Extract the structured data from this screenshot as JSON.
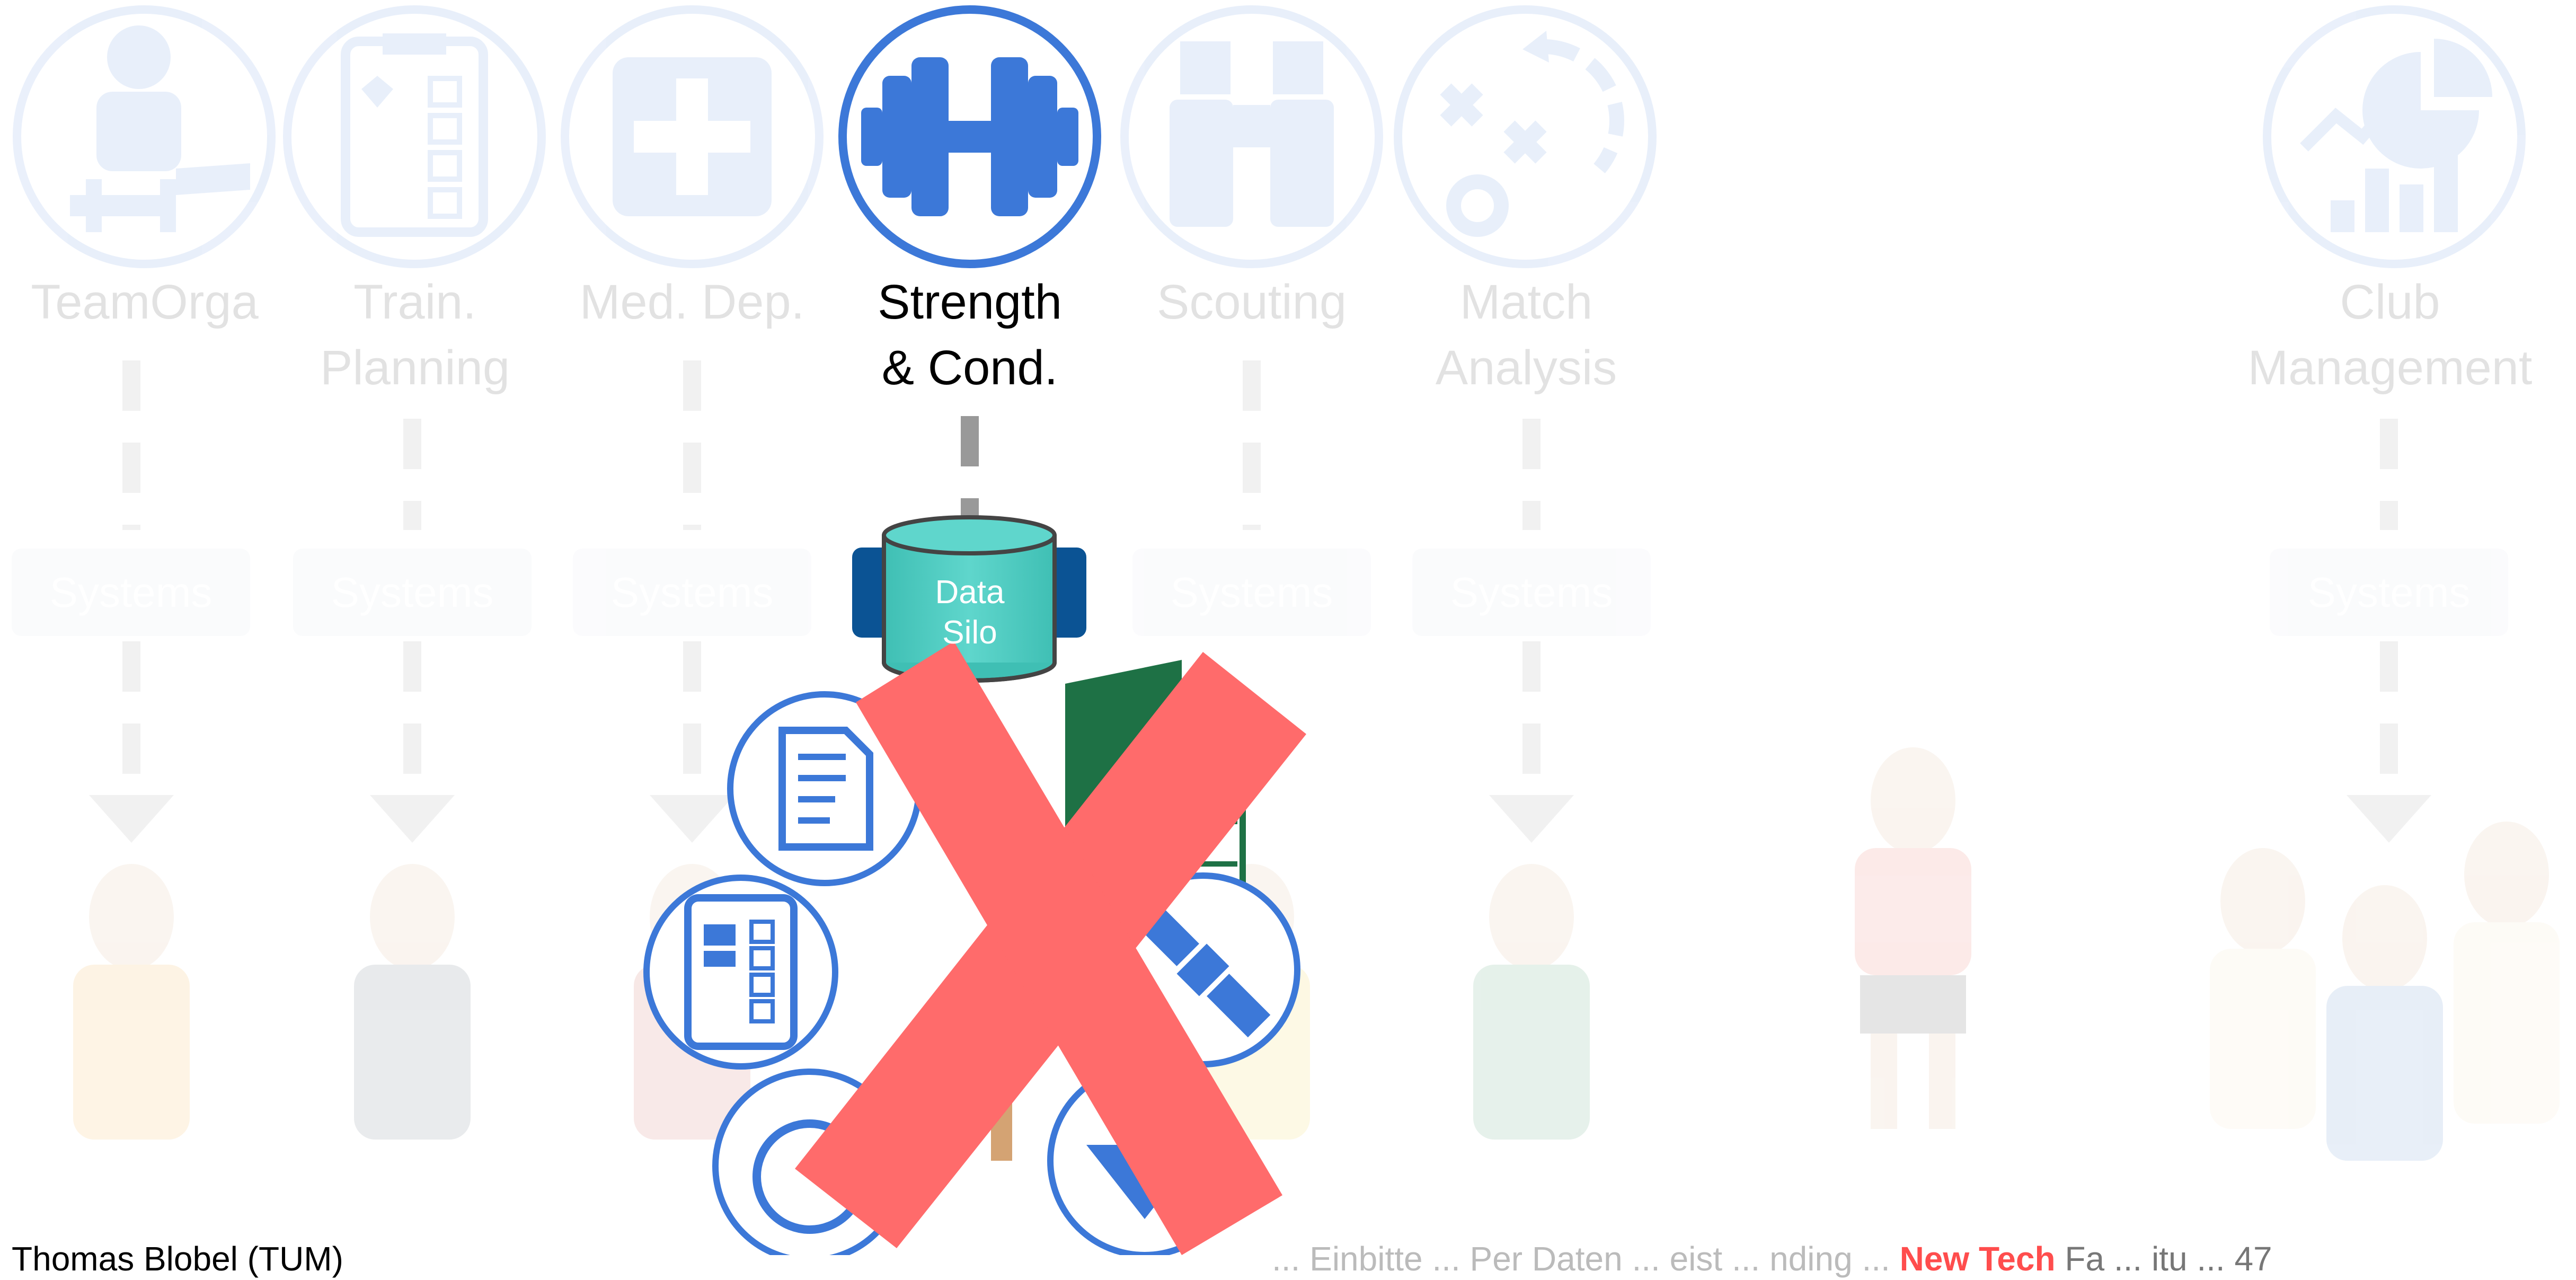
{
  "columns": [
    {
      "id": "teamorga",
      "label_line1": "TeamOrga",
      "label_line2": "",
      "icon": "player-boot-icon",
      "system_label": "Systems",
      "active": false
    },
    {
      "id": "training",
      "label_line1": "Train.",
      "label_line2": "Planning",
      "icon": "clipboard-checklist-icon",
      "system_label": "Systems",
      "active": false
    },
    {
      "id": "medical",
      "label_line1": "Med. Dep.",
      "label_line2": "",
      "icon": "medical-cross-icon",
      "system_label": "Systems",
      "active": false
    },
    {
      "id": "strength",
      "label_line1": "Strength",
      "label_line2": "& Cond.",
      "icon": "dumbbell-icon",
      "system_label": "",
      "active": true
    },
    {
      "id": "scouting",
      "label_line1": "Scouting",
      "label_line2": "",
      "icon": "binoculars-icon",
      "system_label": "Systems",
      "active": false
    },
    {
      "id": "match",
      "label_line1": "Match",
      "label_line2": "Analysis",
      "icon": "tactics-board-icon",
      "system_label": "Systems",
      "active": false
    },
    {
      "id": "club",
      "label_line1": "Club",
      "label_line2": "Management",
      "icon": "analytics-chart-icon",
      "system_label": "Systems",
      "active": false
    }
  ],
  "data_silo": {
    "line1": "Data",
    "line2": "Silo",
    "color": "#4ecdc4",
    "side_color": "#0b5394"
  },
  "accent_color": "#3c78d8",
  "cross_color": "#ff6b6b",
  "tool_icons": [
    "document-icon",
    "excel-icon",
    "checklist-icon",
    "satellite-icon",
    "stopwatch-icon",
    "heart-location-icon"
  ],
  "footer": {
    "left": "Thomas Blobel (TUM)",
    "right_prefix": "... Einbitte ... Per Daten ... eist ... nding ...",
    "right_highlight": "New Tech",
    "right_suffix": "Fa ... itu ... 47"
  }
}
